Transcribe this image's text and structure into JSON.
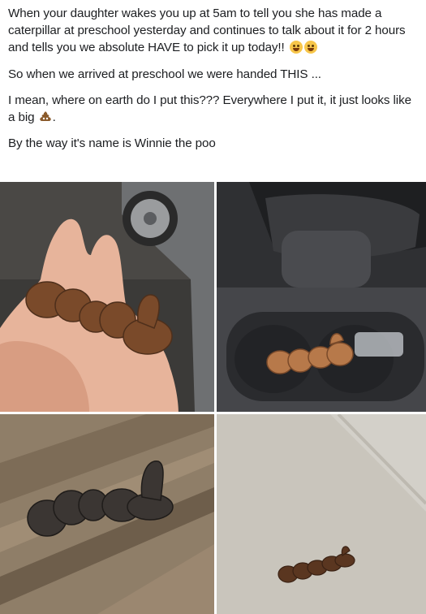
{
  "post": {
    "paragraph_1": "When your daughter wakes you up at 5am to tell you she has made a caterpillar at preschool yesterday and continues to talk about it for 2 hours and tells you we absolute HAVE to pick it up today!!",
    "paragraph_2": "So when we arrived at preschool we were handed THIS ...",
    "paragraph_3": "I mean, where on earth do I put this??? Everywhere I put it, it just looks like a big",
    "paragraph_3_end": ".",
    "paragraph_4": "By the way it's name is Winnie the poo"
  },
  "icons": {
    "p1_emoji_1": "grinning-sweat-emoji",
    "p1_emoji_2": "laughing-tears-emoji",
    "p3_emoji": "pile-of-poo-emoji"
  },
  "photos": [
    {
      "name": "photo-hand"
    },
    {
      "name": "photo-car-cupholder"
    },
    {
      "name": "photo-wood-floor"
    },
    {
      "name": "photo-carpet"
    }
  ],
  "colors": {
    "clay": "#7a4a2a",
    "clay_dark": "#4e2f1b",
    "skin": "#e7b49b",
    "carpet": "#c9c5bc",
    "wood": "#8f7e68"
  }
}
